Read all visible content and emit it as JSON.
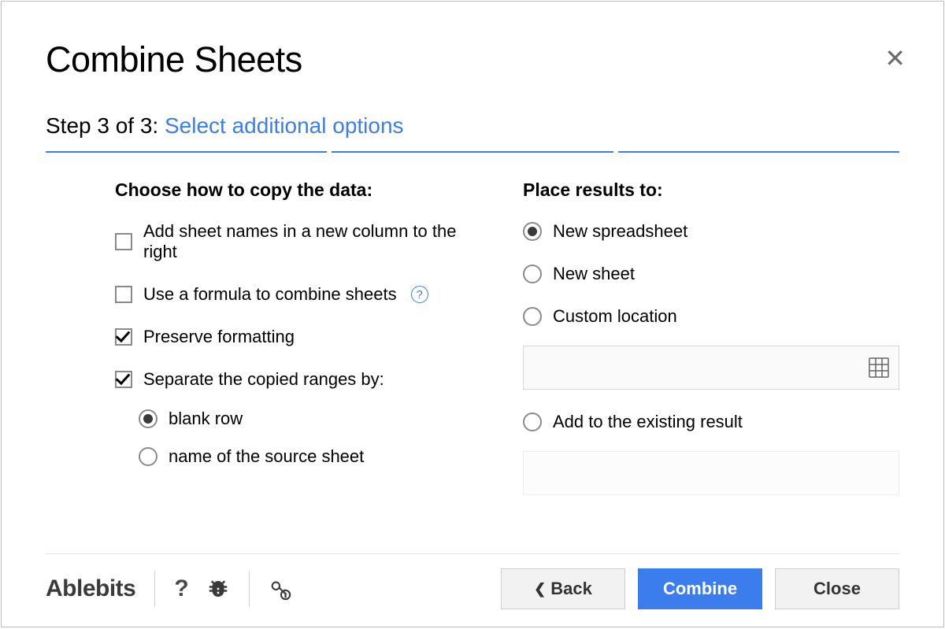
{
  "title": "Combine Sheets",
  "step_prefix": "Step 3 of 3: ",
  "step_subtitle": "Select additional options",
  "left": {
    "heading": "Choose how to copy the data:",
    "add_sheet_names": "Add sheet names in a new column to the right",
    "use_formula": "Use a formula to combine sheets",
    "preserve_formatting": "Preserve formatting",
    "separate_ranges": "Separate the copied ranges by:",
    "blank_row": "blank row",
    "source_name": "name of the source sheet"
  },
  "right": {
    "heading": "Place results to:",
    "new_spreadsheet": "New spreadsheet",
    "new_sheet": "New sheet",
    "custom_location": "Custom location",
    "add_existing": "Add to the existing result"
  },
  "footer": {
    "brand": "Ablebits",
    "back": "Back",
    "combine": "Combine",
    "close": "Close"
  },
  "state": {
    "add_sheet_names_checked": false,
    "use_formula_checked": false,
    "preserve_formatting_checked": true,
    "separate_ranges_checked": true,
    "separator_selected": "blank_row",
    "place_results_selected": "new_spreadsheet"
  }
}
